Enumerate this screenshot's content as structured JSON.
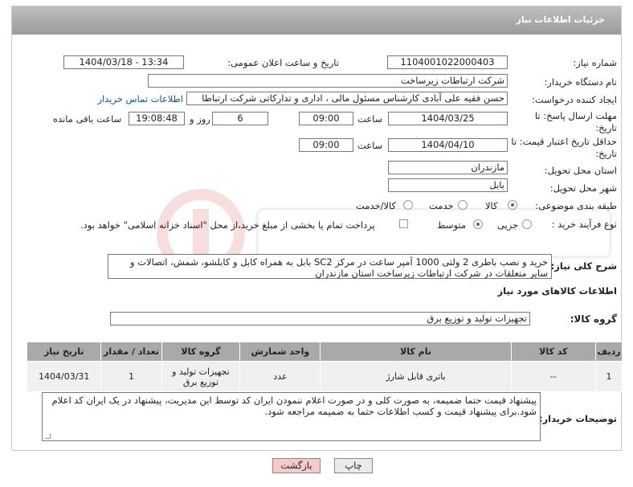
{
  "header": {
    "title": "جزئیات اطلاعات نیاز"
  },
  "need_number": {
    "label": "شماره نیاز:",
    "value": "1104001022000403"
  },
  "announce": {
    "label": "تاریخ و ساعت اعلان عمومی:",
    "value": "1404/03/18 - 13:34"
  },
  "buyer_org": {
    "label": "نام دستگاه خریدار:",
    "value": "شرکت ارتباطات زیرساخت"
  },
  "requester": {
    "label": "ایجاد کننده درخواست:",
    "value": "حسن فقیه علی آبادی کارشناس مسئول مالی ، اداری و تدارکاتی شرکت ارتباطا",
    "contact_link": "اطلاعات تماس خریدار"
  },
  "reply_deadline": {
    "label": "مهلت ارسال پاسخ: تا تاریخ:",
    "date": "1404/03/25",
    "time_label": "ساعت",
    "time": "09:00",
    "days": "6",
    "days_label": "روز و",
    "remaining": "19:08:48",
    "remaining_label": "ساعت باقی مانده"
  },
  "price_validity": {
    "label": "حداقل تاریخ اعتبار قیمت: تا تاریخ:",
    "date": "1404/04/10",
    "time_label": "ساعت",
    "time": "09:00"
  },
  "province": {
    "label": "استان محل تحویل:",
    "value": "مازندران"
  },
  "city": {
    "label": "شهر محل تحویل:",
    "value": "بابل"
  },
  "category": {
    "label": "طبقه بندی موضوعی:",
    "options": [
      "کالا",
      "خدمت",
      "کالا/خدمت"
    ],
    "selected": "کالا"
  },
  "process": {
    "label": "نوع فرآیند خرید :",
    "options": [
      "جزیی",
      "متوسط"
    ],
    "selected": "متوسط",
    "payment_note": "پرداخت تمام یا بخشی از مبلغ خرید،از محل \"اسناد خزانه اسلامی\" خواهد بود."
  },
  "description": {
    "label": "شرح کلی نیاز:",
    "text": "خرید و نصب باطری 2 ولتی 1000 آمپر ساعت در مرکز SC2 بابل به همراه کابل و کابلشو، شمش، اتصالات  و سایر متعلقات در شرکت ارتباطات زیرساخت استان مازندران"
  },
  "goods_info": {
    "title": "اطلاعات کالاهای مورد نیاز"
  },
  "goods_group": {
    "label": "گروه کالا:",
    "value": "تجهیزات تولید و توزیع برق"
  },
  "table": {
    "headers": [
      "ردیف",
      "کد کالا",
      "نام کالا",
      "واحد شمارش",
      "گروه کالا",
      "تعداد / مقدار",
      "تاریخ نیاز"
    ],
    "rows": [
      [
        "1",
        "--",
        "باتری قابل شارژ",
        "عدد",
        "تجهیزات تولید و توزیع برق",
        "1",
        "1404/03/31"
      ]
    ]
  },
  "buyer_notes": {
    "label": "توضیحات خریدار:",
    "text": "پیشنهاد قیمت حتما ضمیمه، به صورت کلی و در صورت اعلام ننمودن ایران کد توسط این مدیریت، پیشنهاد در یک ایران کد اعلام شود.برای پیشنهاد قیمت و کسب اطلاعات حتما به ضمیمه مراجعه شود."
  },
  "buttons": {
    "print": "چاپ",
    "back": "بازگشت"
  },
  "colors": {
    "header": "#a6a6a6",
    "link": "#1a4f9c",
    "table_header": "#a9a9a9",
    "back_button": "#f7c9c9"
  }
}
